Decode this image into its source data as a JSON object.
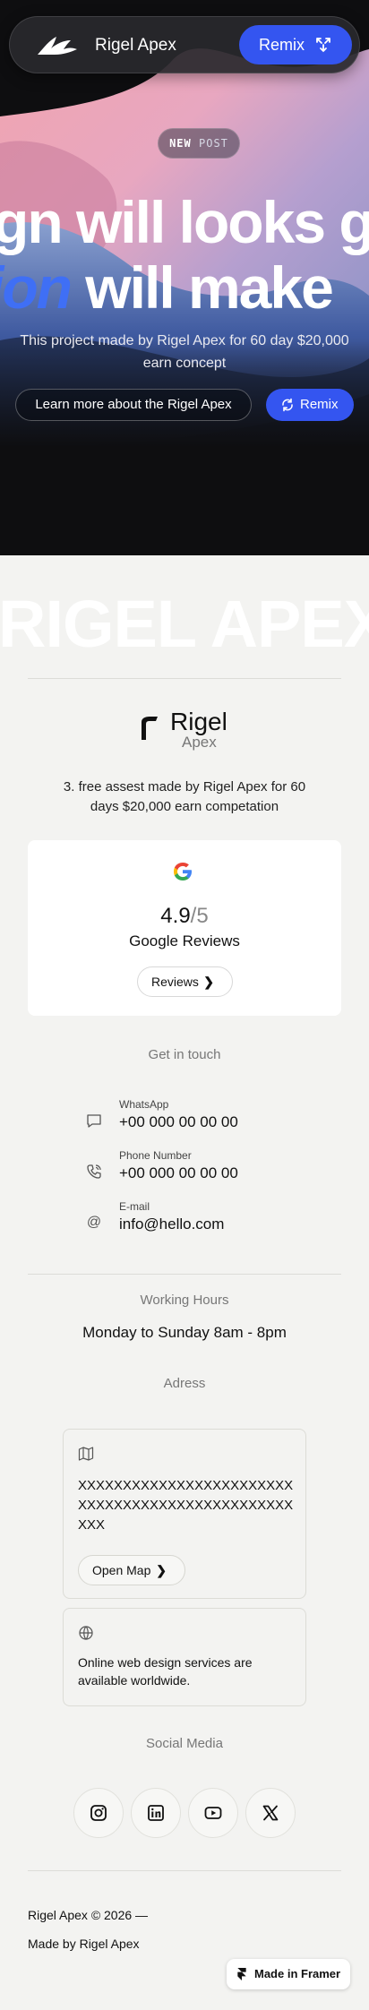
{
  "nav": {
    "brand": "Rigel Apex",
    "remix_label": "Remix"
  },
  "hero": {
    "badge_strong": "NEW",
    "badge_rest": "POST",
    "headline_line1": "gn will looks g",
    "headline_line2_italic": "ion",
    "headline_line2_rest": " will make",
    "subtitle": "This project made by Rigel Apex for 60 day $20,000 earn concept",
    "learn_more_label": "Learn more about the Rigel Apex",
    "remix_label": "Remix"
  },
  "big_brand": "RIGEL APEX",
  "profile": {
    "name_line1": "Rigel",
    "name_line2": "Apex",
    "description": "3. free assest made by Rigel Apex for 60 days $20,000 earn competation"
  },
  "reviews": {
    "score": "4.9",
    "out_of": "/5",
    "label": "Google Reviews",
    "button_label": "Reviews",
    "chevron": "❯"
  },
  "contact": {
    "title": "Get in touch",
    "items": [
      {
        "label": "WhatsApp",
        "value": "+00 000 00 00 00",
        "icon": "chat-icon"
      },
      {
        "label": "Phone Number",
        "value": "+00 000 00 00 00",
        "icon": "phone-icon"
      },
      {
        "label": "E-mail",
        "value": "info@hello.com",
        "icon": "at-icon"
      }
    ]
  },
  "hours": {
    "title": "Working Hours",
    "value": "Monday to Sunday 8am - 8pm"
  },
  "address": {
    "title": "Adress",
    "text": "XXXXXXXXXXXXXXXXXXXXXXXXXXXXXXXXXXXXXXXXXXXXXXXXXXX",
    "open_map_label": "Open Map",
    "online_text": "Online web design services are available worldwide."
  },
  "social": {
    "title": "Social Media",
    "icons": [
      "instagram-icon",
      "linkedin-icon",
      "youtube-icon",
      "x-icon"
    ]
  },
  "footer": {
    "copyright": "Rigel Apex © 2026 —",
    "made_by": "Made by Rigel Apex",
    "framer_badge": "Made in Framer"
  },
  "colors": {
    "accent": "#3455f0",
    "hero_bg": "#0e0e10",
    "page_bg": "#f3f3f1"
  }
}
